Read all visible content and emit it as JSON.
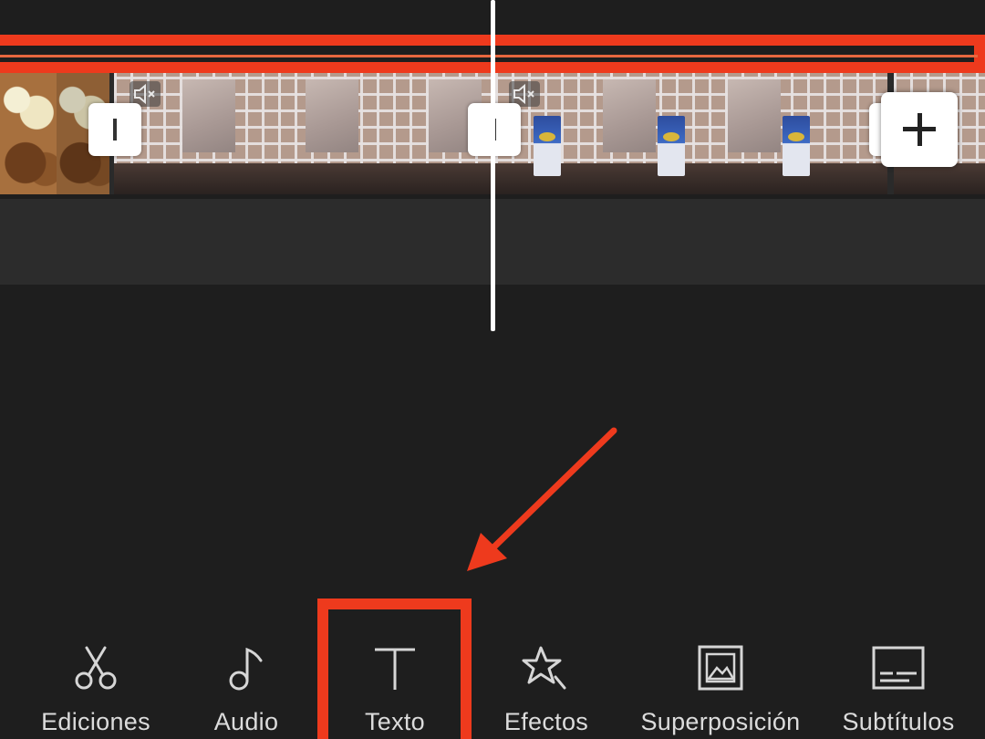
{
  "toolbar": {
    "items": [
      {
        "label": "Ediciones",
        "icon": "scissors-icon"
      },
      {
        "label": "Audio",
        "icon": "music-note-icon"
      },
      {
        "label": "Texto",
        "icon": "text-t-icon"
      },
      {
        "label": "Efectos",
        "icon": "sparkle-star-icon"
      },
      {
        "label": "Superposición",
        "icon": "image-overlay-icon"
      },
      {
        "label": "Subtítulos",
        "icon": "subtitles-icon"
      }
    ]
  },
  "timeline": {
    "add_button_icon": "plus-icon",
    "audio_muted_icon": "speaker-muted-icon"
  },
  "annotation": {
    "color": "#ee3a1d",
    "highlighted_tool": "Texto"
  }
}
